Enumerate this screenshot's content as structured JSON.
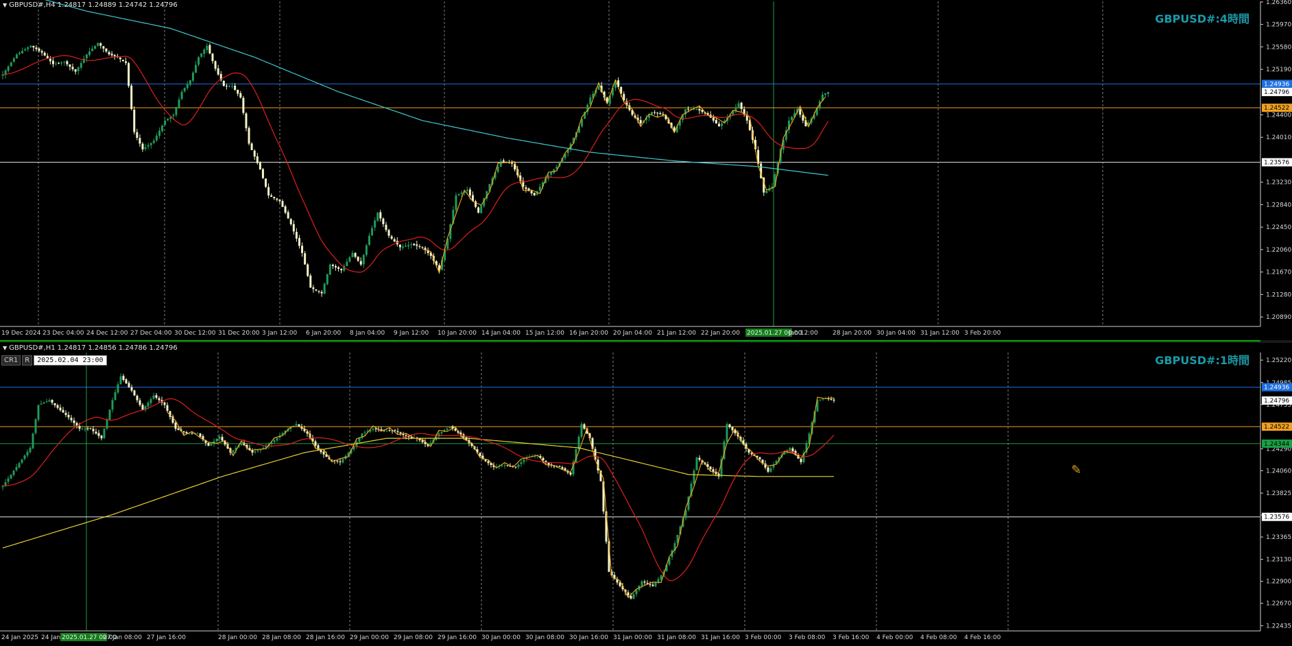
{
  "colors": {
    "background": "#000000",
    "grid": "#808080",
    "bull_candle": "#1f9a5a",
    "bear_candle": "#f4f4c8",
    "ma_short": "#e0201c",
    "ma_long_h4": "#3fc8d0",
    "ma_long_h1": "#e6d030",
    "zigzag": "#f0a818",
    "level_blue": "#1e6fe0",
    "level_orange": "#f0a020",
    "level_white": "#e8e8e8",
    "level_green": "#1aa046",
    "tf_label": "#1a9aa8",
    "axis_text": "#d8d8d8"
  },
  "panes": {
    "h4": {
      "info_line": "GBPUSD#,H4  1.24817 1.24889 1.24742 1.24796",
      "tf_label": "GBPUSD#:4時間",
      "y_range": [
        1.20725,
        1.2637
      ],
      "price_ticks": [
        "1.26360",
        "1.25970",
        "1.25580",
        "1.25190",
        "1.24400",
        "1.24010",
        "1.23230",
        "1.22840",
        "1.22450",
        "1.22060",
        "1.21670",
        "1.21280",
        "1.20890"
      ],
      "level_labels": {
        "blue": "1.24936",
        "current": "1.24796",
        "orange": "1.24522",
        "white": "1.23576"
      },
      "time_labels": [
        "19 Dec 2024",
        "23 Dec 04:00",
        "24 Dec 12:00",
        "27 Dec 04:00",
        "30 Dec 12:00",
        "31 Dec 20:00",
        "3 Jan 12:00",
        "6 Jan 20:00",
        "8 Jan 04:00",
        "9 Jan 12:00",
        "10 Jan 20:00",
        "14 Jan 04:00",
        "15 Jan 12:00",
        "16 Jan 20:00",
        "20 Jan 04:00",
        "21 Jan 12:00",
        "22 Jan 20:00",
        "2025.01.27 00:00",
        "Jan 12:00",
        "28 Jan 20:00",
        "30 Jan 04:00",
        "31 Jan 12:00",
        "3 Feb 20:00"
      ]
    },
    "h1": {
      "info_line": "GBPUSD#,H1  1.24817 1.24856 1.24786 1.24796",
      "tf_label": "GBPUSD#:1時間",
      "cr_label": "CR1",
      "r_label": "R",
      "cursor_datetime": "2025.02.04  23:00",
      "y_range": [
        1.2238,
        1.253
      ],
      "price_ticks": [
        "1.25220",
        "1.24985",
        "1.24755",
        "1.24290",
        "1.24060",
        "1.23825",
        "1.23595",
        "1.23365",
        "1.23130",
        "1.22900",
        "1.22670",
        "1.22435"
      ],
      "level_labels": {
        "blue": "1.24936",
        "current": "1.24796",
        "orange": "1.24522",
        "green": "1.24344",
        "white": "1.23576"
      },
      "time_labels": [
        "24 Jan 2025",
        "24 Jan",
        "2025.01.27 00:00",
        "27 Jan 08:00",
        "27 Jan 16:00",
        "28 Jan 00:00",
        "28 Jan 08:00",
        "28 Jan 16:00",
        "29 Jan 00:00",
        "29 Jan 08:00",
        "29 Jan 16:00",
        "30 Jan 00:00",
        "30 Jan 08:00",
        "30 Jan 16:00",
        "31 Jan 00:00",
        "31 Jan 08:00",
        "31 Jan 16:00",
        "3 Feb 00:00",
        "3 Feb 08:00",
        "3 Feb 16:00",
        "4 Feb 00:00",
        "4 Feb 08:00",
        "4 Feb 16:00"
      ]
    }
  },
  "chart_data": [
    {
      "type": "candlestick",
      "symbol": "GBPUSD#",
      "timeframe": "H4",
      "levels": {
        "blue": 1.24936,
        "orange": 1.24522,
        "white": 1.23576,
        "current": 1.24796
      },
      "close_anchors": [
        [
          0,
          1.251
        ],
        [
          5,
          1.2545
        ],
        [
          10,
          1.256
        ],
        [
          14,
          1.2548
        ],
        [
          18,
          1.2528
        ],
        [
          22,
          1.2532
        ],
        [
          26,
          1.2515
        ],
        [
          30,
          1.2545
        ],
        [
          34,
          1.2565
        ],
        [
          38,
          1.2545
        ],
        [
          41,
          1.254
        ],
        [
          44,
          1.253
        ],
        [
          47,
          1.241
        ],
        [
          50,
          1.238
        ],
        [
          54,
          1.2395
        ],
        [
          58,
          1.243
        ],
        [
          61,
          1.244
        ],
        [
          64,
          1.248
        ],
        [
          67,
          1.25
        ],
        [
          70,
          1.254
        ],
        [
          73,
          1.256
        ],
        [
          76,
          1.252
        ],
        [
          79,
          1.249
        ],
        [
          82,
          1.249
        ],
        [
          85,
          1.247
        ],
        [
          88,
          1.239
        ],
        [
          92,
          1.2345
        ],
        [
          95,
          1.23
        ],
        [
          99,
          1.229
        ],
        [
          103,
          1.225
        ],
        [
          107,
          1.22
        ],
        [
          110,
          1.214
        ],
        [
          114,
          1.213
        ],
        [
          117,
          1.218
        ],
        [
          121,
          1.217
        ],
        [
          125,
          1.22
        ],
        [
          128,
          1.218
        ],
        [
          131,
          1.223
        ],
        [
          134,
          1.227
        ],
        [
          138,
          1.223
        ],
        [
          142,
          1.221
        ],
        [
          146,
          1.2215
        ],
        [
          150,
          1.221
        ],
        [
          153,
          1.2195
        ],
        [
          156,
          1.217
        ],
        [
          159,
          1.2225
        ],
        [
          162,
          1.23
        ],
        [
          166,
          1.231
        ],
        [
          170,
          1.227
        ],
        [
          174,
          1.232
        ],
        [
          178,
          1.236
        ],
        [
          182,
          1.2355
        ],
        [
          186,
          1.2315
        ],
        [
          190,
          1.23
        ],
        [
          194,
          1.233
        ],
        [
          198,
          1.235
        ],
        [
          202,
          1.238
        ],
        [
          206,
          1.242
        ],
        [
          210,
          1.247
        ],
        [
          213,
          1.249
        ],
        [
          216,
          1.246
        ],
        [
          219,
          1.25
        ],
        [
          222,
          1.2465
        ],
        [
          225,
          1.244
        ],
        [
          228,
          1.2425
        ],
        [
          232,
          1.2445
        ],
        [
          236,
          1.244
        ],
        [
          240,
          1.241
        ],
        [
          244,
          1.245
        ],
        [
          248,
          1.245
        ],
        [
          252,
          1.244
        ],
        [
          256,
          1.242
        ],
        [
          260,
          1.244
        ],
        [
          263,
          1.246
        ],
        [
          266,
          1.243
        ],
        [
          269,
          1.238
        ],
        [
          272,
          1.2305
        ],
        [
          275,
          1.2315
        ],
        [
          278,
          1.238
        ],
        [
          281,
          1.243
        ],
        [
          284,
          1.245
        ],
        [
          287,
          1.242
        ],
        [
          290,
          1.244
        ],
        [
          293,
          1.2475
        ],
        [
          295,
          1.24796
        ]
      ]
    },
    {
      "type": "candlestick",
      "symbol": "GBPUSD#",
      "timeframe": "H1",
      "levels": {
        "blue": 1.24936,
        "orange": 1.24522,
        "green": 1.24344,
        "white": 1.23576,
        "current": 1.24796
      },
      "close_anchors": [
        [
          0,
          1.239
        ],
        [
          5,
          1.241
        ],
        [
          10,
          1.243
        ],
        [
          13,
          1.2475
        ],
        [
          17,
          1.248
        ],
        [
          20,
          1.2472
        ],
        [
          24,
          1.2462
        ],
        [
          28,
          1.245
        ],
        [
          32,
          1.245
        ],
        [
          36,
          1.244
        ],
        [
          40,
          1.248
        ],
        [
          43,
          1.2505
        ],
        [
          47,
          1.249
        ],
        [
          51,
          1.247
        ],
        [
          55,
          1.2485
        ],
        [
          59,
          1.2475
        ],
        [
          63,
          1.245
        ],
        [
          67,
          1.2445
        ],
        [
          71,
          1.2445
        ],
        [
          75,
          1.2432
        ],
        [
          79,
          1.2442
        ],
        [
          83,
          1.2425
        ],
        [
          87,
          1.2435
        ],
        [
          91,
          1.2425
        ],
        [
          95,
          1.243
        ],
        [
          99,
          1.2438
        ],
        [
          103,
          1.2448
        ],
        [
          107,
          1.2455
        ],
        [
          111,
          1.2445
        ],
        [
          115,
          1.2428
        ],
        [
          119,
          1.2418
        ],
        [
          123,
          1.2415
        ],
        [
          127,
          1.2428
        ],
        [
          131,
          1.2445
        ],
        [
          135,
          1.245
        ],
        [
          139,
          1.2448
        ],
        [
          143,
          1.2448
        ],
        [
          147,
          1.2442
        ],
        [
          151,
          1.244
        ],
        [
          155,
          1.2432
        ],
        [
          159,
          1.2445
        ],
        [
          163,
          1.2452
        ],
        [
          167,
          1.2444
        ],
        [
          171,
          1.2432
        ],
        [
          175,
          1.2418
        ],
        [
          179,
          1.241
        ],
        [
          183,
          1.2412
        ],
        [
          187,
          1.241
        ],
        [
          191,
          1.242
        ],
        [
          195,
          1.2422
        ],
        [
          199,
          1.2412
        ],
        [
          203,
          1.241
        ],
        [
          207,
          1.2402
        ],
        [
          211,
          1.2455
        ],
        [
          214,
          1.244
        ],
        [
          218,
          1.2395
        ],
        [
          221,
          1.23
        ],
        [
          225,
          1.2285
        ],
        [
          229,
          1.2272
        ],
        [
          233,
          1.229
        ],
        [
          237,
          1.2285
        ],
        [
          241,
          1.23
        ],
        [
          245,
          1.233
        ],
        [
          249,
          1.2365
        ],
        [
          253,
          1.242
        ],
        [
          257,
          1.241
        ],
        [
          261,
          1.24
        ],
        [
          264,
          1.2455
        ],
        [
          268,
          1.2442
        ],
        [
          272,
          1.2425
        ],
        [
          276,
          1.2418
        ],
        [
          279,
          1.2405
        ],
        [
          283,
          1.242
        ],
        [
          287,
          1.243
        ],
        [
          291,
          1.2415
        ],
        [
          294,
          1.2445
        ],
        [
          297,
          1.248
        ],
        [
          300,
          1.2482
        ],
        [
          303,
          1.24796
        ]
      ]
    }
  ]
}
